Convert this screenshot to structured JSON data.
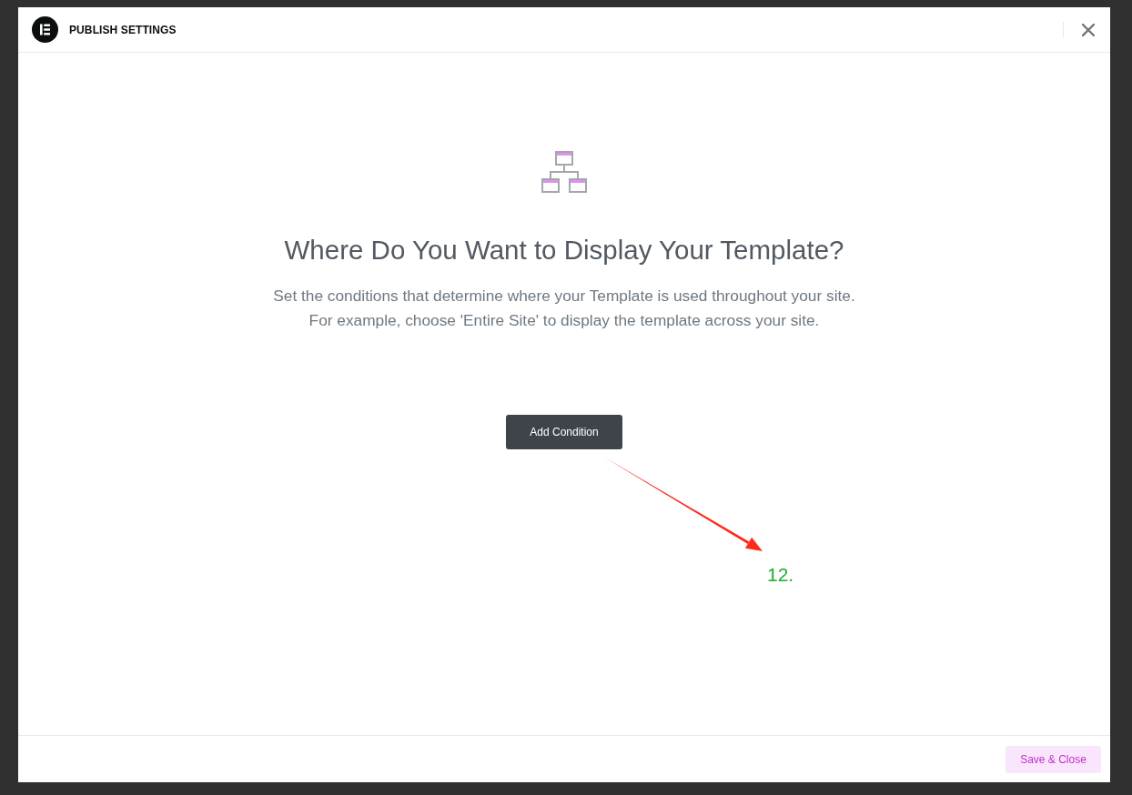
{
  "dialog": {
    "title": "PUBLISH SETTINGS"
  },
  "heading": "Where Do You Want to Display Your Template?",
  "description_lines": [
    "Set the conditions that determine where your Template is used throughout your site.",
    "For example, choose 'Entire Site' to display the template across your site."
  ],
  "add_button": {
    "label": "Add Condition"
  },
  "annotation": {
    "label": "12."
  },
  "footer": {
    "save_button": {
      "label": "Save & Close"
    }
  }
}
